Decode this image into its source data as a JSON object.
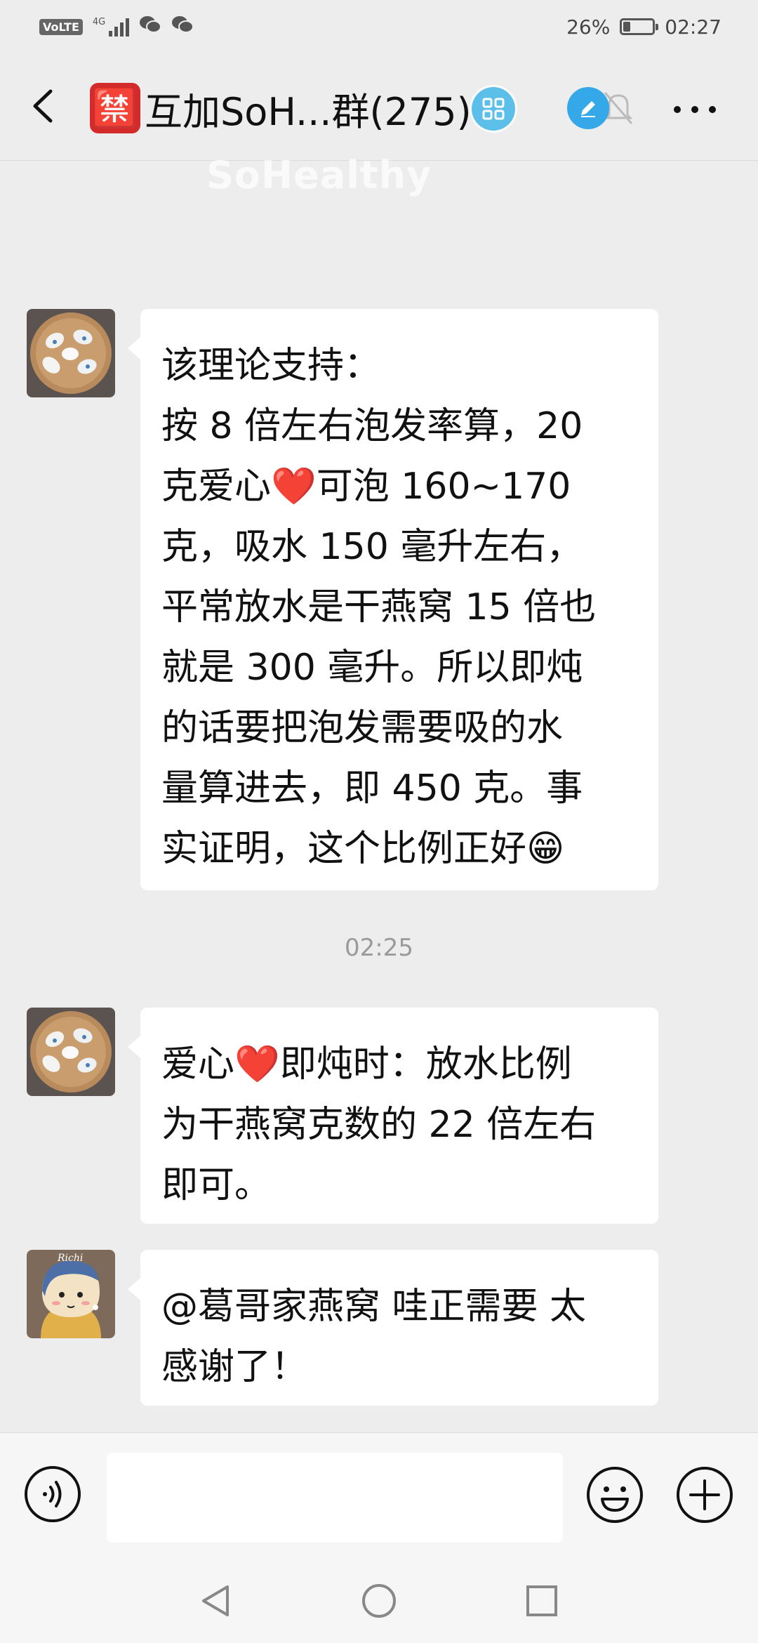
{
  "status_bar": {
    "volte": "VoLTE",
    "network": "4G",
    "battery": "26%",
    "battery_level": 0.26,
    "time": "02:27"
  },
  "header": {
    "badge": "🈲",
    "title": "互加SoH...群(275)",
    "icons": [
      "back-arrow-icon",
      "mini-program-icon",
      "edit-icon",
      "mute-bell-icon",
      "more-icon"
    ]
  },
  "watermark": "SoHealthy",
  "messages": [
    {
      "avatar": "bird-nest-avatar",
      "lines": [
        "该理论支持：",
        "按 8 倍左右泡发率算，20",
        "克爱心❤️可泡 160~170",
        "克，吸水 150 毫升左右，",
        "平常放水是干燕窝 15 倍也",
        "就是 300 毫升。所以即炖",
        "的话要把泡发需要吸的水",
        "量算进去，即 450 克。事",
        "实证明，这个比例正好😁"
      ]
    },
    {
      "avatar": "bird-nest-avatar",
      "lines": [
        "爱心❤️即炖时：放水比例",
        "为干燕窝克数的 22 倍左右",
        "即可。"
      ]
    },
    {
      "avatar": "cartoon-girl-avatar",
      "avatar_text": "Richi",
      "lines": [
        "@葛哥家燕窝  哇正需要 太",
        "感谢了！"
      ]
    }
  ],
  "timestamp": "02:25",
  "input_bar": {
    "placeholder": "",
    "icons": [
      "voice-icon",
      "emoji-icon",
      "plus-icon"
    ]
  },
  "system_nav": [
    "back-triangle-icon",
    "home-circle-icon",
    "recents-square-icon"
  ]
}
